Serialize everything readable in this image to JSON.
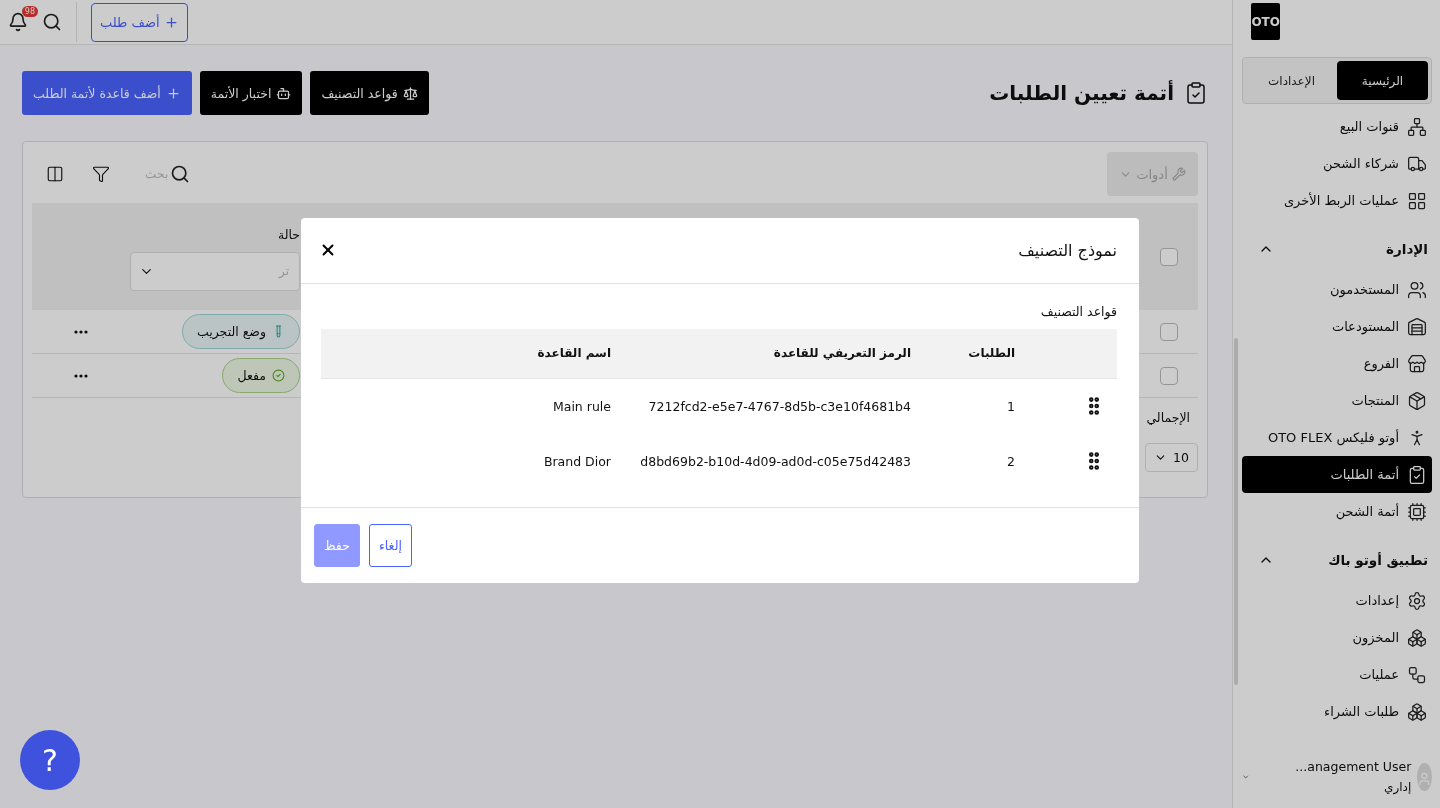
{
  "topbar": {
    "notification_count": "98",
    "add_order_button": "أضف طلب"
  },
  "page": {
    "title": "أتمة تعيين الطلبات",
    "actions": [
      {
        "label": "قواعد التصنيف",
        "kind": "dark"
      },
      {
        "label": "اختبار الأتمة",
        "kind": "dark"
      },
      {
        "label": "أضف قاعدة لأتمة الطلب",
        "kind": "primary"
      }
    ]
  },
  "table": {
    "tools_button": "أدوات",
    "search_placeholder": "بحث",
    "header_checked": false,
    "status_header": "حالة",
    "status_filter_placeholder": "تر",
    "rows": [
      {
        "checked": false,
        "status": "وضع التجريب",
        "kind": "test"
      },
      {
        "checked": false,
        "status": "مفعل",
        "kind": "active"
      }
    ],
    "total_label": "الإجمالي",
    "page_size": "10"
  },
  "dialog": {
    "title": "نموذج التصنيف",
    "section_label": "قواعد التصنيف",
    "columns": [
      "الطلبات",
      "الرمز التعريفي للقاعدة",
      "اسم القاعدة"
    ],
    "rows": [
      {
        "orders": "1",
        "rule_id": "7212fcd2-e5e7-4767-8d5b-c3e10f4681b4",
        "rule_name": "Main rule"
      },
      {
        "orders": "2",
        "rule_id": "d8bd69b2-b10d-4d09-ad0d-c05e75d42483",
        "rule_name": "Brand Dior"
      }
    ],
    "buttons": [
      {
        "label": "إلغاء",
        "kind": "secondary",
        "disabled": false
      },
      {
        "label": "حفظ",
        "kind": "primary",
        "disabled": true
      }
    ]
  },
  "sidebar": {
    "logo": "OTO",
    "tabs": [
      {
        "label": "الرئيسية",
        "selected": true
      },
      {
        "label": "الإعدادات",
        "selected": false
      }
    ],
    "groups": [
      {
        "items": [
          {
            "label": "قنوات البيع",
            "selected": false
          },
          {
            "label": "شركاء الشحن",
            "selected": false
          },
          {
            "label": "عمليات الربط الأخرى",
            "selected": false
          }
        ]
      },
      {
        "title": "الإدارة",
        "expanded": true,
        "items": [
          {
            "label": "المستخدمون",
            "selected": false
          },
          {
            "label": "المستودعات",
            "selected": false
          },
          {
            "label": "الفروع",
            "selected": false
          },
          {
            "label": "المنتجات",
            "selected": false
          },
          {
            "label": "أوتو فليكس OTO FLEX",
            "selected": false
          },
          {
            "label": "أتمة الطلبات",
            "selected": true
          },
          {
            "label": "أتمة الشحن",
            "selected": false
          }
        ]
      },
      {
        "title": "تطبيق أوتو باك",
        "expanded": true,
        "items": [
          {
            "label": "إعدادات",
            "selected": false
          },
          {
            "label": "المخزون",
            "selected": false
          },
          {
            "label": "عمليات",
            "selected": false
          },
          {
            "label": "طلبات الشراء",
            "selected": false
          }
        ]
      }
    ],
    "user": {
      "name": "...anagement User",
      "role": "إداري"
    }
  },
  "help_button": "?"
}
